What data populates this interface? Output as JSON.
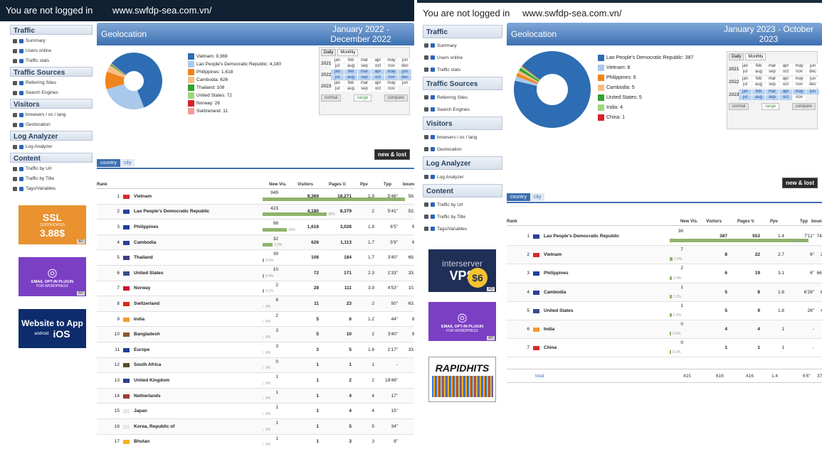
{
  "panels": [
    {
      "login_status": "You are not logged in",
      "site_url": "www.swfdp-sea.com.vn/",
      "sidebar": [
        {
          "section": "Traffic",
          "items": [
            "Summary",
            "Users online",
            "Traffic stats"
          ]
        },
        {
          "section": "Traffic Sources",
          "items": [
            "Referring Sites",
            "Search Engines"
          ]
        },
        {
          "section": "Visitors",
          "items": [
            "browsers / os / lang",
            "Geolocation"
          ]
        },
        {
          "section": "Log Analyzer",
          "items": [
            "Log Analyzer"
          ]
        },
        {
          "section": "Content",
          "items": [
            "Traffic by Url",
            "Traffic by Title",
            "Tags/Variables"
          ]
        }
      ],
      "ads": [
        {
          "kind": "ssl",
          "line1": "SSL",
          "line2": "CERTIFICATES",
          "line3": "3.88$",
          "side": "per year",
          "tag": "AD"
        },
        {
          "kind": "optin",
          "line1": "EMAIL OPT-IN PLUGIN",
          "line2": "FOR WORDPRESS",
          "tag": "AD"
        },
        {
          "kind": "app",
          "line1": "Website to App",
          "line2": "iOS",
          "sub": "android"
        }
      ],
      "geo_title": "Geolocation",
      "period": "January 2022 - December 2022",
      "legend": [
        {
          "label": "Vietnam: 9,369",
          "color": "#2d6db3",
          "value": 9369
        },
        {
          "label": "Lao People's Democratic Republic: 4,180",
          "color": "#aac8ea",
          "value": 4180
        },
        {
          "label": "Philippines: 1,618",
          "color": "#f0841c",
          "value": 1618
        },
        {
          "label": "Cambodia: 626",
          "color": "#f6be85",
          "value": 626
        },
        {
          "label": "Thailand: 108",
          "color": "#35a035",
          "value": 108
        },
        {
          "label": "United States: 72",
          "color": "#9ed77b",
          "value": 72
        },
        {
          "label": "Norway: 28",
          "color": "#d4232a",
          "value": 28
        },
        {
          "label": "Switzerland: 11",
          "color": "#f69a9b",
          "value": 11
        }
      ],
      "calendar": {
        "tabs": [
          "Daily",
          "Monthly"
        ],
        "years": [
          {
            "year": "2021",
            "months": [
              "jan",
              "feb",
              "mar",
              "apr",
              "may",
              "jun",
              "jul",
              "aug",
              "sep",
              "oct",
              "nov",
              "dec"
            ],
            "sel_from": -1,
            "sel_to": -1
          },
          {
            "year": "2022",
            "months": [
              "jan",
              "feb",
              "mar",
              "apr",
              "may",
              "jun",
              "jul",
              "aug",
              "sep",
              "oct",
              "nov",
              "dec"
            ],
            "sel_from": 0,
            "sel_to": 11
          },
          {
            "year": "2023",
            "months": [
              "jan",
              "feb",
              "mar",
              "apr",
              "may",
              "jun",
              "jul",
              "aug",
              "sep",
              "oct",
              "nov"
            ],
            "sel_from": -1,
            "sel_to": -1
          }
        ],
        "buttons": [
          "normal",
          "range",
          "compare"
        ]
      },
      "new_lost": "new & lost",
      "tabs": [
        "country",
        "city"
      ],
      "columns": {
        "rank": "Rank",
        "new": "New Vis.",
        "visitors": "Visitors",
        "pages": "Pages V.",
        "ppv": "Ppv",
        "tpp": "Tpp",
        "bounce": "bounce"
      },
      "rows": [
        {
          "rank": "1",
          "country": "Vietnam",
          "flag": "#d62b2b",
          "new": "949",
          "visitors": "9,369",
          "pages": "18,271",
          "ppv": "1.9",
          "tpp": "5'46\"",
          "bounce": "58.4%",
          "share": 1.0,
          "pct": "58.4%"
        },
        {
          "rank": "2",
          "country": "Lao People's Democratic Republic",
          "flag": "#2a3f9a",
          "new": "423",
          "visitors": "4,180",
          "pages": "8,379",
          "ppv": "2",
          "tpp": "5'41\"",
          "bounce": "53.9%",
          "share": 0.45,
          "pct": "26%"
        },
        {
          "rank": "3",
          "country": "Philippines",
          "flag": "#1d3f9a",
          "new": "98",
          "visitors": "1,618",
          "pages": "3,028",
          "ppv": "1.8",
          "tpp": "6'5\"",
          "bounce": "64%",
          "share": 0.17,
          "pct": "10%"
        },
        {
          "rank": "4",
          "country": "Cambodia",
          "flag": "#2d3f9a",
          "new": "32",
          "visitors": "626",
          "pages": "1,113",
          "ppv": "1.7",
          "tpp": "5'9\"",
          "bounce": "61%",
          "share": 0.07,
          "pct": "3.9%"
        },
        {
          "rank": "5",
          "country": "Thailand",
          "flag": "#3d3f8a",
          "new": "39",
          "visitors": "108",
          "pages": "184",
          "ppv": "1.7",
          "tpp": "3'40\"",
          "bounce": "69.4%",
          "share": 0.01,
          "pct": "0.6%"
        },
        {
          "rank": "6",
          "country": "United States",
          "flag": "#3a4c8c",
          "new": "10",
          "visitors": "72",
          "pages": "171",
          "ppv": "2.3",
          "tpp": "1'33\"",
          "bounce": "33.3%",
          "share": 0.008,
          "pct": "0.4%"
        },
        {
          "rank": "7",
          "country": "Norway",
          "flag": "#c8102e",
          "new": "2",
          "visitors": "28",
          "pages": "111",
          "ppv": "3.9",
          "tpp": "4'53\"",
          "bounce": "10.7%",
          "share": 0.002,
          "pct": "0.1%"
        },
        {
          "rank": "8",
          "country": "Switzerland",
          "flag": "#d52b1e",
          "new": "8",
          "visitors": "11",
          "pages": "23",
          "ppv": "2",
          "tpp": "50\"",
          "bounce": "63.6%",
          "share": 0,
          "pct": "0%"
        },
        {
          "rank": "9",
          "country": "India",
          "flag": "#f49a2f",
          "new": "2",
          "visitors": "5",
          "pages": "6",
          "ppv": "1.2",
          "tpp": "44\"",
          "bounce": "80%",
          "share": 0,
          "pct": "0%"
        },
        {
          "rank": "10",
          "country": "Bangladesh",
          "flag": "#8a5a2a",
          "new": "3",
          "visitors": "5",
          "pages": "10",
          "ppv": "2",
          "tpp": "3'40\"",
          "bounce": "80%",
          "share": 0,
          "pct": "0%"
        },
        {
          "rank": "11",
          "country": "Europe",
          "flag": "#1f3f9a",
          "new": "3",
          "visitors": "3",
          "pages": "5",
          "ppv": "1.6",
          "tpp": "1'17\"",
          "bounce": "33.3%",
          "share": 0,
          "pct": "0%"
        },
        {
          "rank": "12",
          "country": "South Africa",
          "flag": "#5a4a2a",
          "new": "0",
          "visitors": "1",
          "pages": "1",
          "ppv": "1",
          "tpp": "-",
          "bounce": "0%",
          "share": 0,
          "pct": "0%"
        },
        {
          "rank": "13",
          "country": "United Kingdom",
          "flag": "#2a3f8a",
          "new": "1",
          "visitors": "1",
          "pages": "2",
          "ppv": "2",
          "tpp": "18'48\"",
          "bounce": "0%",
          "share": 0,
          "pct": "0%"
        },
        {
          "rank": "14",
          "country": "Netherlands",
          "flag": "#a03a3a",
          "new": "1",
          "visitors": "1",
          "pages": "4",
          "ppv": "4",
          "tpp": "17\"",
          "bounce": "0%",
          "share": 0,
          "pct": "0%"
        },
        {
          "rank": "15",
          "country": "Japan",
          "flag": "#e8e8e8",
          "new": "1",
          "visitors": "1",
          "pages": "4",
          "ppv": "4",
          "tpp": "15\"",
          "bounce": "0%",
          "share": 0,
          "pct": "0%"
        },
        {
          "rank": "16",
          "country": "Korea, Republic of",
          "flag": "#e8e8e8",
          "new": "1",
          "visitors": "1",
          "pages": "5",
          "ppv": "5",
          "tpp": "34\"",
          "bounce": "0%",
          "share": 0,
          "pct": "0%"
        },
        {
          "rank": "17",
          "country": "Bhutan",
          "flag": "#f2b21f",
          "new": "1",
          "visitors": "1",
          "pages": "3",
          "ppv": "3",
          "tpp": "8\"",
          "bounce": "0%",
          "share": 0,
          "pct": "0%"
        }
      ],
      "total": null
    },
    {
      "login_status": "You are not logged in",
      "site_url": "www.swfdp-sea.com.vn/",
      "sidebar": [
        {
          "section": "Traffic",
          "items": [
            "Summary",
            "Users online",
            "Traffic stats"
          ]
        },
        {
          "section": "Traffic Sources",
          "items": [
            "Referring Sites",
            "Search Engines"
          ]
        },
        {
          "section": "Visitors",
          "items": [
            "browsers / os / lang",
            "Geolocation"
          ]
        },
        {
          "section": "Log Analyzer",
          "items": [
            "Log Analyzer"
          ]
        },
        {
          "section": "Content",
          "items": [
            "Traffic by Url",
            "Traffic by Title",
            "Tags/Variables"
          ]
        }
      ],
      "ads": [
        {
          "kind": "vps",
          "line1": "interserver",
          "line2": "VPS",
          "line3": "$6",
          "tag": "AD"
        },
        {
          "kind": "optin",
          "line1": "EMAIL OPT-IN PLUGIN",
          "line2": "FOR WORDPRESS",
          "tag": "AD"
        },
        {
          "kind": "rapid",
          "line1": "RAPIDHITS"
        }
      ],
      "geo_title": "Geolocation",
      "period": "January 2023 - October 2023",
      "legend": [
        {
          "label": "Lao People's Democratic Republic: 387",
          "color": "#2d6db3",
          "value": 387
        },
        {
          "label": "Vietnam: 8",
          "color": "#aac8ea",
          "value": 8
        },
        {
          "label": "Philippines: 6",
          "color": "#f0841c",
          "value": 6
        },
        {
          "label": "Cambodia: 5",
          "color": "#f6be85",
          "value": 5
        },
        {
          "label": "United States: 5",
          "color": "#35a035",
          "value": 5
        },
        {
          "label": "India: 4",
          "color": "#9ed77b",
          "value": 4
        },
        {
          "label": "China: 1",
          "color": "#d4232a",
          "value": 1
        }
      ],
      "calendar": {
        "tabs": [
          "Daily",
          "Monthly"
        ],
        "years": [
          {
            "year": "2021",
            "months": [
              "jan",
              "feb",
              "mar",
              "apr",
              "may",
              "jun",
              "jul",
              "aug",
              "sep",
              "oct",
              "nov",
              "dec"
            ],
            "sel_from": -1,
            "sel_to": -1
          },
          {
            "year": "2022",
            "months": [
              "jan",
              "feb",
              "mar",
              "apr",
              "may",
              "jun",
              "jul",
              "aug",
              "sep",
              "oct",
              "nov",
              "dec"
            ],
            "sel_from": -1,
            "sel_to": -1
          },
          {
            "year": "2023",
            "months": [
              "jan",
              "feb",
              "mar",
              "apr",
              "may",
              "jun",
              "jul",
              "aug",
              "sep",
              "oct",
              "nov"
            ],
            "sel_from": 0,
            "sel_to": 9
          }
        ],
        "buttons": [
          "normal",
          "range",
          "compare"
        ]
      },
      "new_lost": "new & lost",
      "tabs": [
        "country",
        "city"
      ],
      "columns": {
        "rank": "Rank",
        "new": "New Vis.",
        "visitors": "Visitors",
        "pages": "Pages V.",
        "ppv": "Ppv",
        "tpp": "Tpp",
        "bounce": "bounce"
      },
      "rows": [
        {
          "rank": "1",
          "country": "Lao People's Democratic Republic",
          "flag": "#2a3f9a",
          "new": "36",
          "visitors": "387",
          "pages": "553",
          "ppv": "1.4",
          "tpp": "7'11\"",
          "bounce": "74.1%",
          "share": 1.0,
          "pct": "93%"
        },
        {
          "rank": "2",
          "country": "Vietnam",
          "flag": "#d62b2b",
          "new": "7",
          "visitors": "8",
          "pages": "22",
          "ppv": "2.7",
          "tpp": "6\"",
          "bounce": "25%",
          "share": 0.02,
          "pct": "1.9%"
        },
        {
          "rank": "3",
          "country": "Philippines",
          "flag": "#1d3f9a",
          "new": "2",
          "visitors": "6",
          "pages": "19",
          "ppv": "3.1",
          "tpp": "6\"",
          "bounce": "66.6%",
          "share": 0.015,
          "pct": "1.4%"
        },
        {
          "rank": "4",
          "country": "Cambodia",
          "flag": "#2d3f9a",
          "new": "1",
          "visitors": "5",
          "pages": "8",
          "ppv": "1.6",
          "tpp": "6'28\"",
          "bounce": "60%",
          "share": 0.013,
          "pct": "1.2%"
        },
        {
          "rank": "5",
          "country": "United States",
          "flag": "#3a4c8c",
          "new": "1",
          "visitors": "5",
          "pages": "9",
          "ppv": "1.8",
          "tpp": "26\"",
          "bounce": "40%",
          "share": 0.013,
          "pct": "1.2%"
        },
        {
          "rank": "6",
          "country": "India",
          "flag": "#f49a2f",
          "new": "0",
          "visitors": "4",
          "pages": "4",
          "ppv": "1",
          "tpp": "-",
          "bounce": "0%",
          "share": 0.01,
          "pct": "0.9%"
        },
        {
          "rank": "7",
          "country": "China",
          "flag": "#d62b2b",
          "new": "0",
          "visitors": "1",
          "pages": "1",
          "ppv": "1",
          "tpp": "-",
          "bounce": "0%",
          "share": 0.002,
          "pct": "0.2%"
        }
      ],
      "total": {
        "label": "total",
        "new": "415",
        "visitors": "616",
        "pages": "416",
        "ppv": "1.4",
        "tpp": "6'6\"",
        "bounce": "37.8%"
      }
    }
  ]
}
